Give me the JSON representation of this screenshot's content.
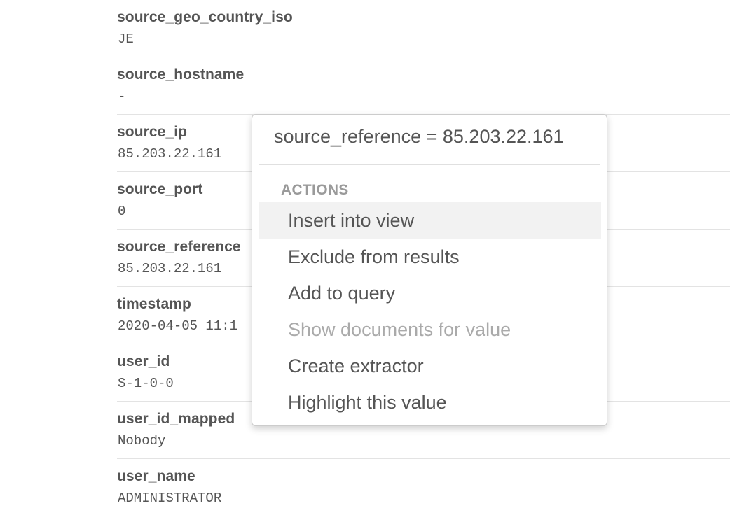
{
  "fields": [
    {
      "name": "source_geo_country_iso",
      "value": "JE"
    },
    {
      "name": "source_hostname",
      "value": "-"
    },
    {
      "name": "source_ip",
      "value": "85.203.22.161"
    },
    {
      "name": "source_port",
      "value": "0"
    },
    {
      "name": "source_reference",
      "value": "85.203.22.161"
    },
    {
      "name": "timestamp",
      "value": "2020-04-05 11:1"
    },
    {
      "name": "user_id",
      "value": "S-1-0-0"
    },
    {
      "name": "user_id_mapped",
      "value": "Nobody"
    },
    {
      "name": "user_name",
      "value": "ADMINISTRATOR"
    }
  ],
  "popover": {
    "title": "source_reference = 85.203.22.161",
    "actions_header": "ACTIONS",
    "items": [
      {
        "label": "Insert into view",
        "state": "hover"
      },
      {
        "label": "Exclude from results",
        "state": "normal"
      },
      {
        "label": "Add to query",
        "state": "normal"
      },
      {
        "label": "Show documents for value",
        "state": "disabled"
      },
      {
        "label": "Create extractor",
        "state": "normal"
      },
      {
        "label": "Highlight this value",
        "state": "normal"
      }
    ]
  },
  "colors": {
    "text": "#555555",
    "muted": "#9a9a9a",
    "disabled": "#aaaaaa",
    "hover_bg": "#f2f2f2",
    "divider": "#e3e3e3"
  }
}
